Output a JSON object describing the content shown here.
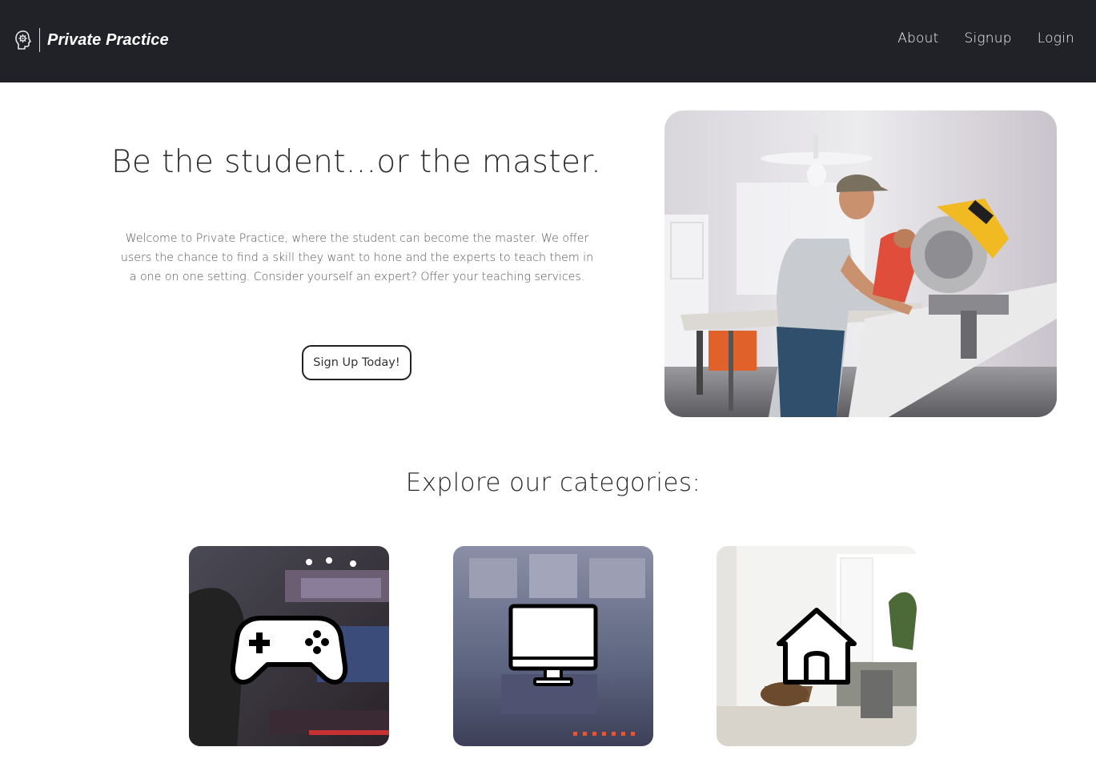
{
  "header": {
    "brand_name": "Private Practice",
    "logo_icon": "head-gear-icon",
    "nav": [
      {
        "label": "About"
      },
      {
        "label": "Signup"
      },
      {
        "label": "Login"
      }
    ]
  },
  "hero": {
    "title": "Be the student...or the master.",
    "text": "Welcome to Private Practice, where the student can become the master. We offer users the chance to find a skill they want to hone and the experts to teach them in a one on one setting. Consider yourself an expert? Offer your teaching services.",
    "cta_label": "Sign Up Today!",
    "image_icon": "carpenter-photo"
  },
  "categories": {
    "title": "Explore our categories:",
    "items": [
      {
        "icon": "game-controller-icon"
      },
      {
        "icon": "computer-monitor-icon"
      },
      {
        "icon": "house-icon"
      }
    ]
  },
  "colors": {
    "navbar": "#212227",
    "text": "#2a2a2a"
  }
}
